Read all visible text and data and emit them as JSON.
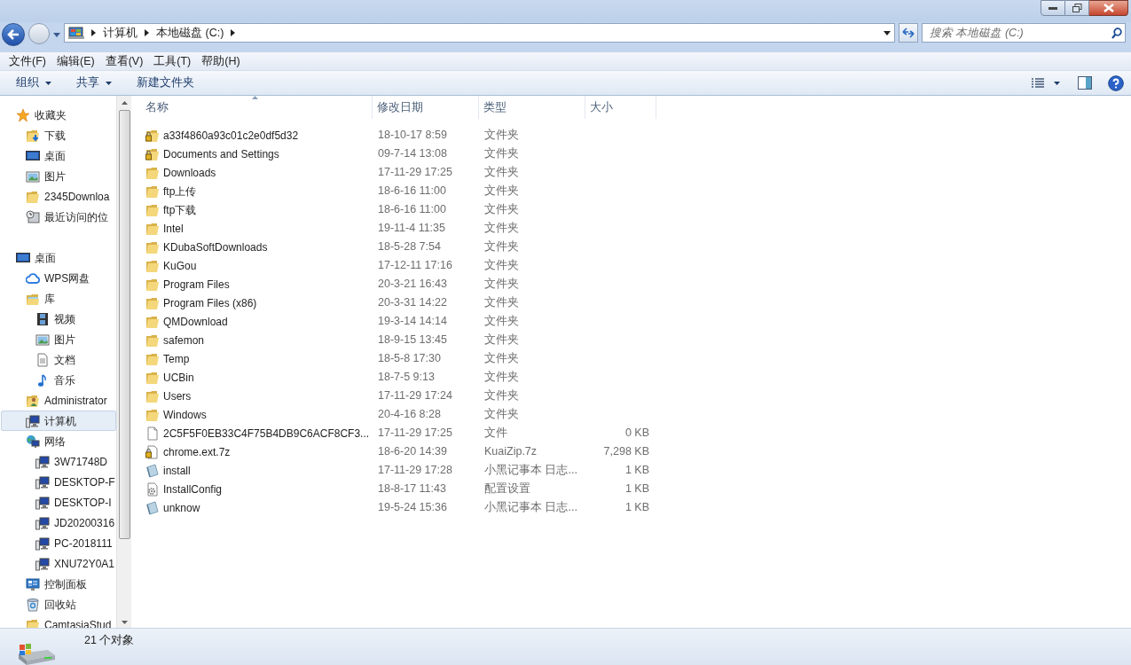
{
  "address": {
    "crumbs": [
      "计算机",
      "本地磁盘 (C:)"
    ]
  },
  "search": {
    "placeholder": "搜索 本地磁盘 (C:)"
  },
  "menu": [
    "文件(F)",
    "编辑(E)",
    "查看(V)",
    "工具(T)",
    "帮助(H)"
  ],
  "toolbar": [
    {
      "label": "组织",
      "dropdown": true
    },
    {
      "label": "共享",
      "dropdown": true
    },
    {
      "label": "新建文件夹",
      "dropdown": false
    }
  ],
  "sidebar": {
    "items": [
      {
        "label": "收藏夹",
        "kind": "star",
        "selected": false,
        "children": [
          {
            "label": "下载",
            "kind": "download",
            "selected": false
          },
          {
            "label": "桌面",
            "kind": "desktop",
            "selected": false
          },
          {
            "label": "图片",
            "kind": "picture",
            "selected": false
          },
          {
            "label": "2345Downloa",
            "kind": "folder",
            "selected": false
          },
          {
            "label": "最近访问的位",
            "kind": "recent",
            "selected": false
          }
        ]
      },
      {
        "label": "桌面",
        "kind": "desktop",
        "selected": false,
        "children": [
          {
            "label": "WPS网盘",
            "kind": "cloud",
            "selected": false
          },
          {
            "label": "库",
            "kind": "library",
            "selected": false,
            "children": [
              {
                "label": "视频",
                "kind": "video",
                "selected": false
              },
              {
                "label": "图片",
                "kind": "picture",
                "selected": false
              },
              {
                "label": "文档",
                "kind": "document",
                "selected": false
              },
              {
                "label": "音乐",
                "kind": "music",
                "selected": false
              }
            ]
          },
          {
            "label": "Administrator",
            "kind": "user",
            "selected": false
          },
          {
            "label": "计算机",
            "kind": "computer",
            "selected": true
          },
          {
            "label": "网络",
            "kind": "network",
            "selected": false,
            "children": [
              {
                "label": "3W71748D",
                "kind": "computer",
                "selected": false
              },
              {
                "label": "DESKTOP-F",
                "kind": "computer",
                "selected": false
              },
              {
                "label": "DESKTOP-I",
                "kind": "computer",
                "selected": false
              },
              {
                "label": "JD20200316",
                "kind": "computer",
                "selected": false
              },
              {
                "label": "PC-2018111",
                "kind": "computer",
                "selected": false
              },
              {
                "label": "XNU72Y0A1",
                "kind": "computer",
                "selected": false
              }
            ]
          },
          {
            "label": "控制面板",
            "kind": "control",
            "selected": false
          },
          {
            "label": "回收站",
            "kind": "recycle",
            "selected": false
          },
          {
            "label": "CamtasiaStud",
            "kind": "folder",
            "selected": false
          }
        ]
      }
    ]
  },
  "table": {
    "columns": [
      "名称",
      "修改日期",
      "类型",
      "大小"
    ],
    "rows": [
      {
        "kind": "locked-folder",
        "name": "a33f4860a93c01c2e0df5d32",
        "date": "18-10-17 8:59",
        "type": "文件夹"
      },
      {
        "kind": "locked-folder",
        "name": "Documents and Settings",
        "date": "09-7-14 13:08",
        "type": "文件夹"
      },
      {
        "kind": "folder",
        "name": "Downloads",
        "date": "17-11-29 17:25",
        "type": "文件夹"
      },
      {
        "kind": "folder",
        "name": "ftp上传",
        "date": "18-6-16 11:00",
        "type": "文件夹"
      },
      {
        "kind": "folder",
        "name": "ftp下载",
        "date": "18-6-16 11:00",
        "type": "文件夹"
      },
      {
        "kind": "folder",
        "name": "Intel",
        "date": "19-11-4 11:35",
        "type": "文件夹"
      },
      {
        "kind": "folder",
        "name": "KDubaSoftDownloads",
        "date": "18-5-28 7:54",
        "type": "文件夹"
      },
      {
        "kind": "folder",
        "name": "KuGou",
        "date": "17-12-11 17:16",
        "type": "文件夹"
      },
      {
        "kind": "folder",
        "name": "Program Files",
        "date": "20-3-21 16:43",
        "type": "文件夹"
      },
      {
        "kind": "folder",
        "name": "Program Files (x86)",
        "date": "20-3-31 14:22",
        "type": "文件夹"
      },
      {
        "kind": "folder",
        "name": "QMDownload",
        "date": "19-3-14 14:14",
        "type": "文件夹"
      },
      {
        "kind": "folder",
        "name": "safemon",
        "date": "18-9-15 13:45",
        "type": "文件夹"
      },
      {
        "kind": "folder",
        "name": "Temp",
        "date": "18-5-8 17:30",
        "type": "文件夹"
      },
      {
        "kind": "folder",
        "name": "UCBin",
        "date": "18-7-5 9:13",
        "type": "文件夹"
      },
      {
        "kind": "folder",
        "name": "Users",
        "date": "17-11-29 17:24",
        "type": "文件夹"
      },
      {
        "kind": "folder",
        "name": "Windows",
        "date": "20-4-16 8:28",
        "type": "文件夹"
      },
      {
        "kind": "file",
        "name": "2C5F5F0EB33C4F75B4DB9C6ACF8CF3...",
        "date": "17-11-29 17:25",
        "type": "文件",
        "size": "0 KB"
      },
      {
        "kind": "locked-file",
        "name": "chrome.ext.7z",
        "date": "18-6-20 14:39",
        "type": "KuaiZip.7z",
        "size": "7,298 KB"
      },
      {
        "kind": "notepad",
        "name": "install",
        "date": "17-11-29 17:28",
        "type": "小黑记事本 日志...",
        "size": "1 KB"
      },
      {
        "kind": "config",
        "name": "InstallConfig",
        "date": "18-8-17 11:43",
        "type": "配置设置",
        "size": "1 KB"
      },
      {
        "kind": "notepad",
        "name": "unknow",
        "date": "19-5-24 15:36",
        "type": "小黑记事本 日志...",
        "size": "1 KB"
      }
    ]
  },
  "status_bar": {
    "count": "21 个对象"
  }
}
